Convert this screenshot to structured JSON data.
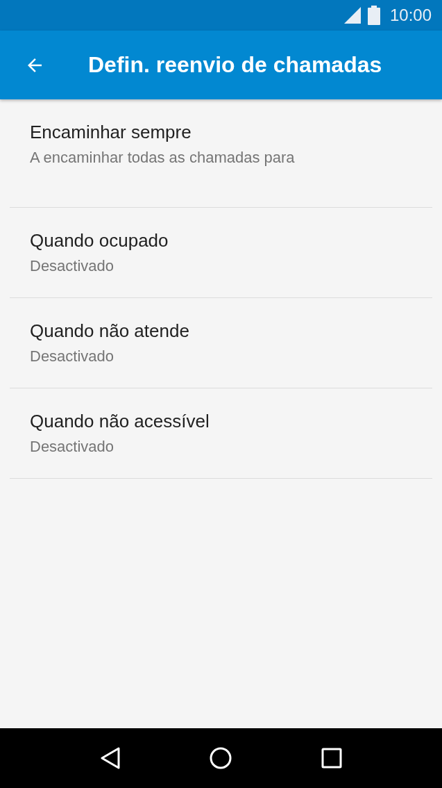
{
  "status_bar": {
    "time": "10:00"
  },
  "toolbar": {
    "title": "Defin. reenvio de chamadas"
  },
  "settings": [
    {
      "title": "Encaminhar sempre",
      "summary": "A encaminhar todas as chamadas para"
    },
    {
      "title": "Quando ocupado",
      "summary": "Desactivado"
    },
    {
      "title": "Quando não atende",
      "summary": "Desactivado"
    },
    {
      "title": "Quando não acessível",
      "summary": "Desactivado"
    }
  ]
}
